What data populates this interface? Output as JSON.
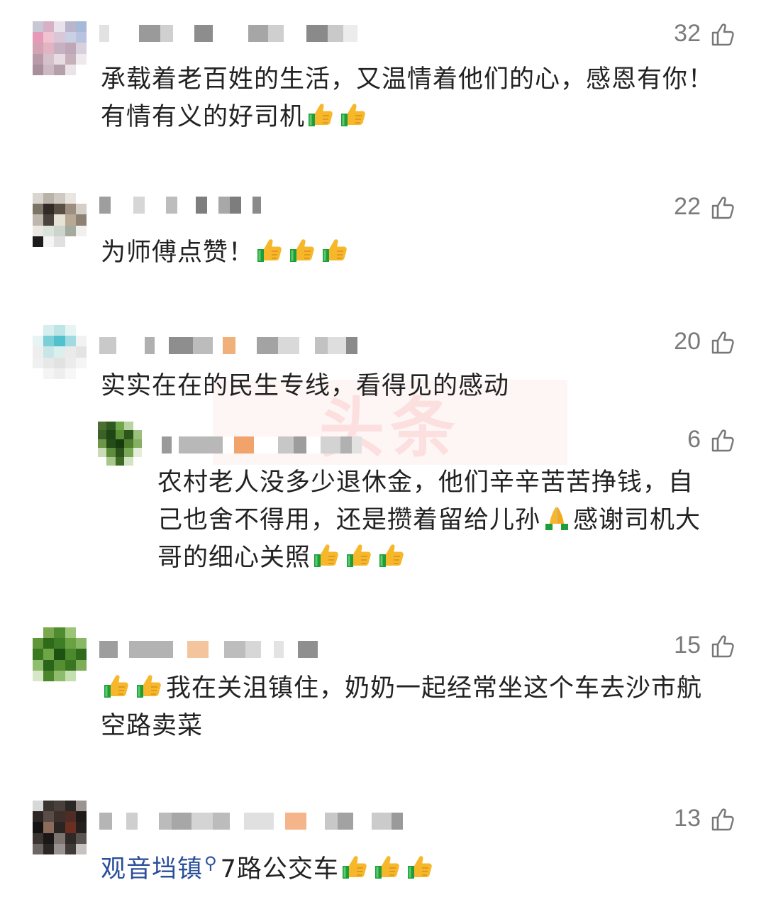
{
  "comments": [
    {
      "likes": "32",
      "line1": "承载着老百姓的生活，又温情着他们的心，感恩有你！",
      "line2": "有情有义的好司机"
    },
    {
      "likes": "22",
      "line1": "为师傅点赞！"
    },
    {
      "likes": "20",
      "line1": "实实在在的民生专线，看得见的感动",
      "reply": {
        "likes": "6",
        "line1": "农村老人没多少退休金，他们辛辛苦苦挣钱，自",
        "line2a": "己也舍不得用，还是攒着留给儿孙",
        "line2b": "感谢司机大",
        "line3": "哥的细心关照"
      }
    },
    {
      "likes": "15",
      "line1": "我在关沮镇住，奶奶一起经常坐这个车去沙市航",
      "line2": "空路卖菜"
    },
    {
      "likes": "13",
      "link": "观音垱镇",
      "search_mark": "⚲",
      "text_after": "7路公交车"
    }
  ],
  "watermark": "头条",
  "icons": {
    "like": "thumb-up-outline-icon",
    "emoji": "thumbs-up-emoji-icon",
    "pray": "folded-hands-emoji-icon"
  },
  "colors": {
    "link": "#2b4f9a",
    "like_count": "#7a7a7a"
  }
}
